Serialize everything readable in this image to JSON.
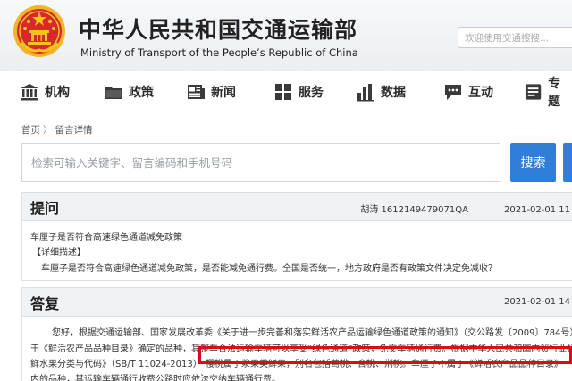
{
  "header": {
    "site_name_cn": "中华人民共和国交通运输部",
    "site_name_en": "Ministry of Transport of the People’s Republic of China",
    "search_placeholder": "欢迎使用交通搜搜..."
  },
  "nav": {
    "items": [
      {
        "label": "机构",
        "icon": "institution-icon"
      },
      {
        "label": "政策",
        "icon": "folder-icon"
      },
      {
        "label": "新闻",
        "icon": "newspaper-icon"
      },
      {
        "label": "服务",
        "icon": "service-grid-icon"
      },
      {
        "label": "数据",
        "icon": "bar-chart-icon"
      },
      {
        "label": "互动",
        "icon": "chat-bubble-icon"
      },
      {
        "label": "专题",
        "icon": "topic-icon"
      }
    ]
  },
  "breadcrumb": {
    "home": "首页",
    "separator": "〉",
    "current": "留言详情"
  },
  "search": {
    "placeholder": "检索可输入关键字、留言编码和手机号码",
    "button_label": "搜索"
  },
  "question": {
    "heading": "提问",
    "author": "胡涛 1612149479071QA",
    "date": "2021-02-01 11",
    "title": "车厘子是否符合高速绿色通道减免政策",
    "detail_label": "【详细描述】",
    "detail_text": "车厘子是否符合高速绿色通道减免政策，是否能减免通行费。全国是否统一，地方政府是否有政策文件决定免减收？"
  },
  "answer": {
    "heading": "答复",
    "date": "2021-02-01 14",
    "lines": [
      "您好，根据交通运输部、国家发展改革委《关于进一步完善和落实鲜活农产品运输绿色通道政策的通知》（交公路发〔2009〕784号），",
      "于《鲜活农产品品种目录》确定的品种，其整车合法运输车辆可以享受“绿色通道”政策，免交车辆通行费。根据中华人民共和国内贸行业标",
      "鲜水果分类与代码》（SB/T 11024-2013）",
      "樱桃属于浆果类鲜果，别名包括莺桃、含桃、荆桃。车厘子不属于《鲜活农产品品种目录》",
      "内的品种，其运输车辆通行收费公路时应依法交纳车辆通行费。"
    ]
  },
  "colors": {
    "accent": "#2f7fd8",
    "highlight": "#e0061b",
    "emblem_red": "#d7282f",
    "emblem_gold": "#f5c518"
  }
}
